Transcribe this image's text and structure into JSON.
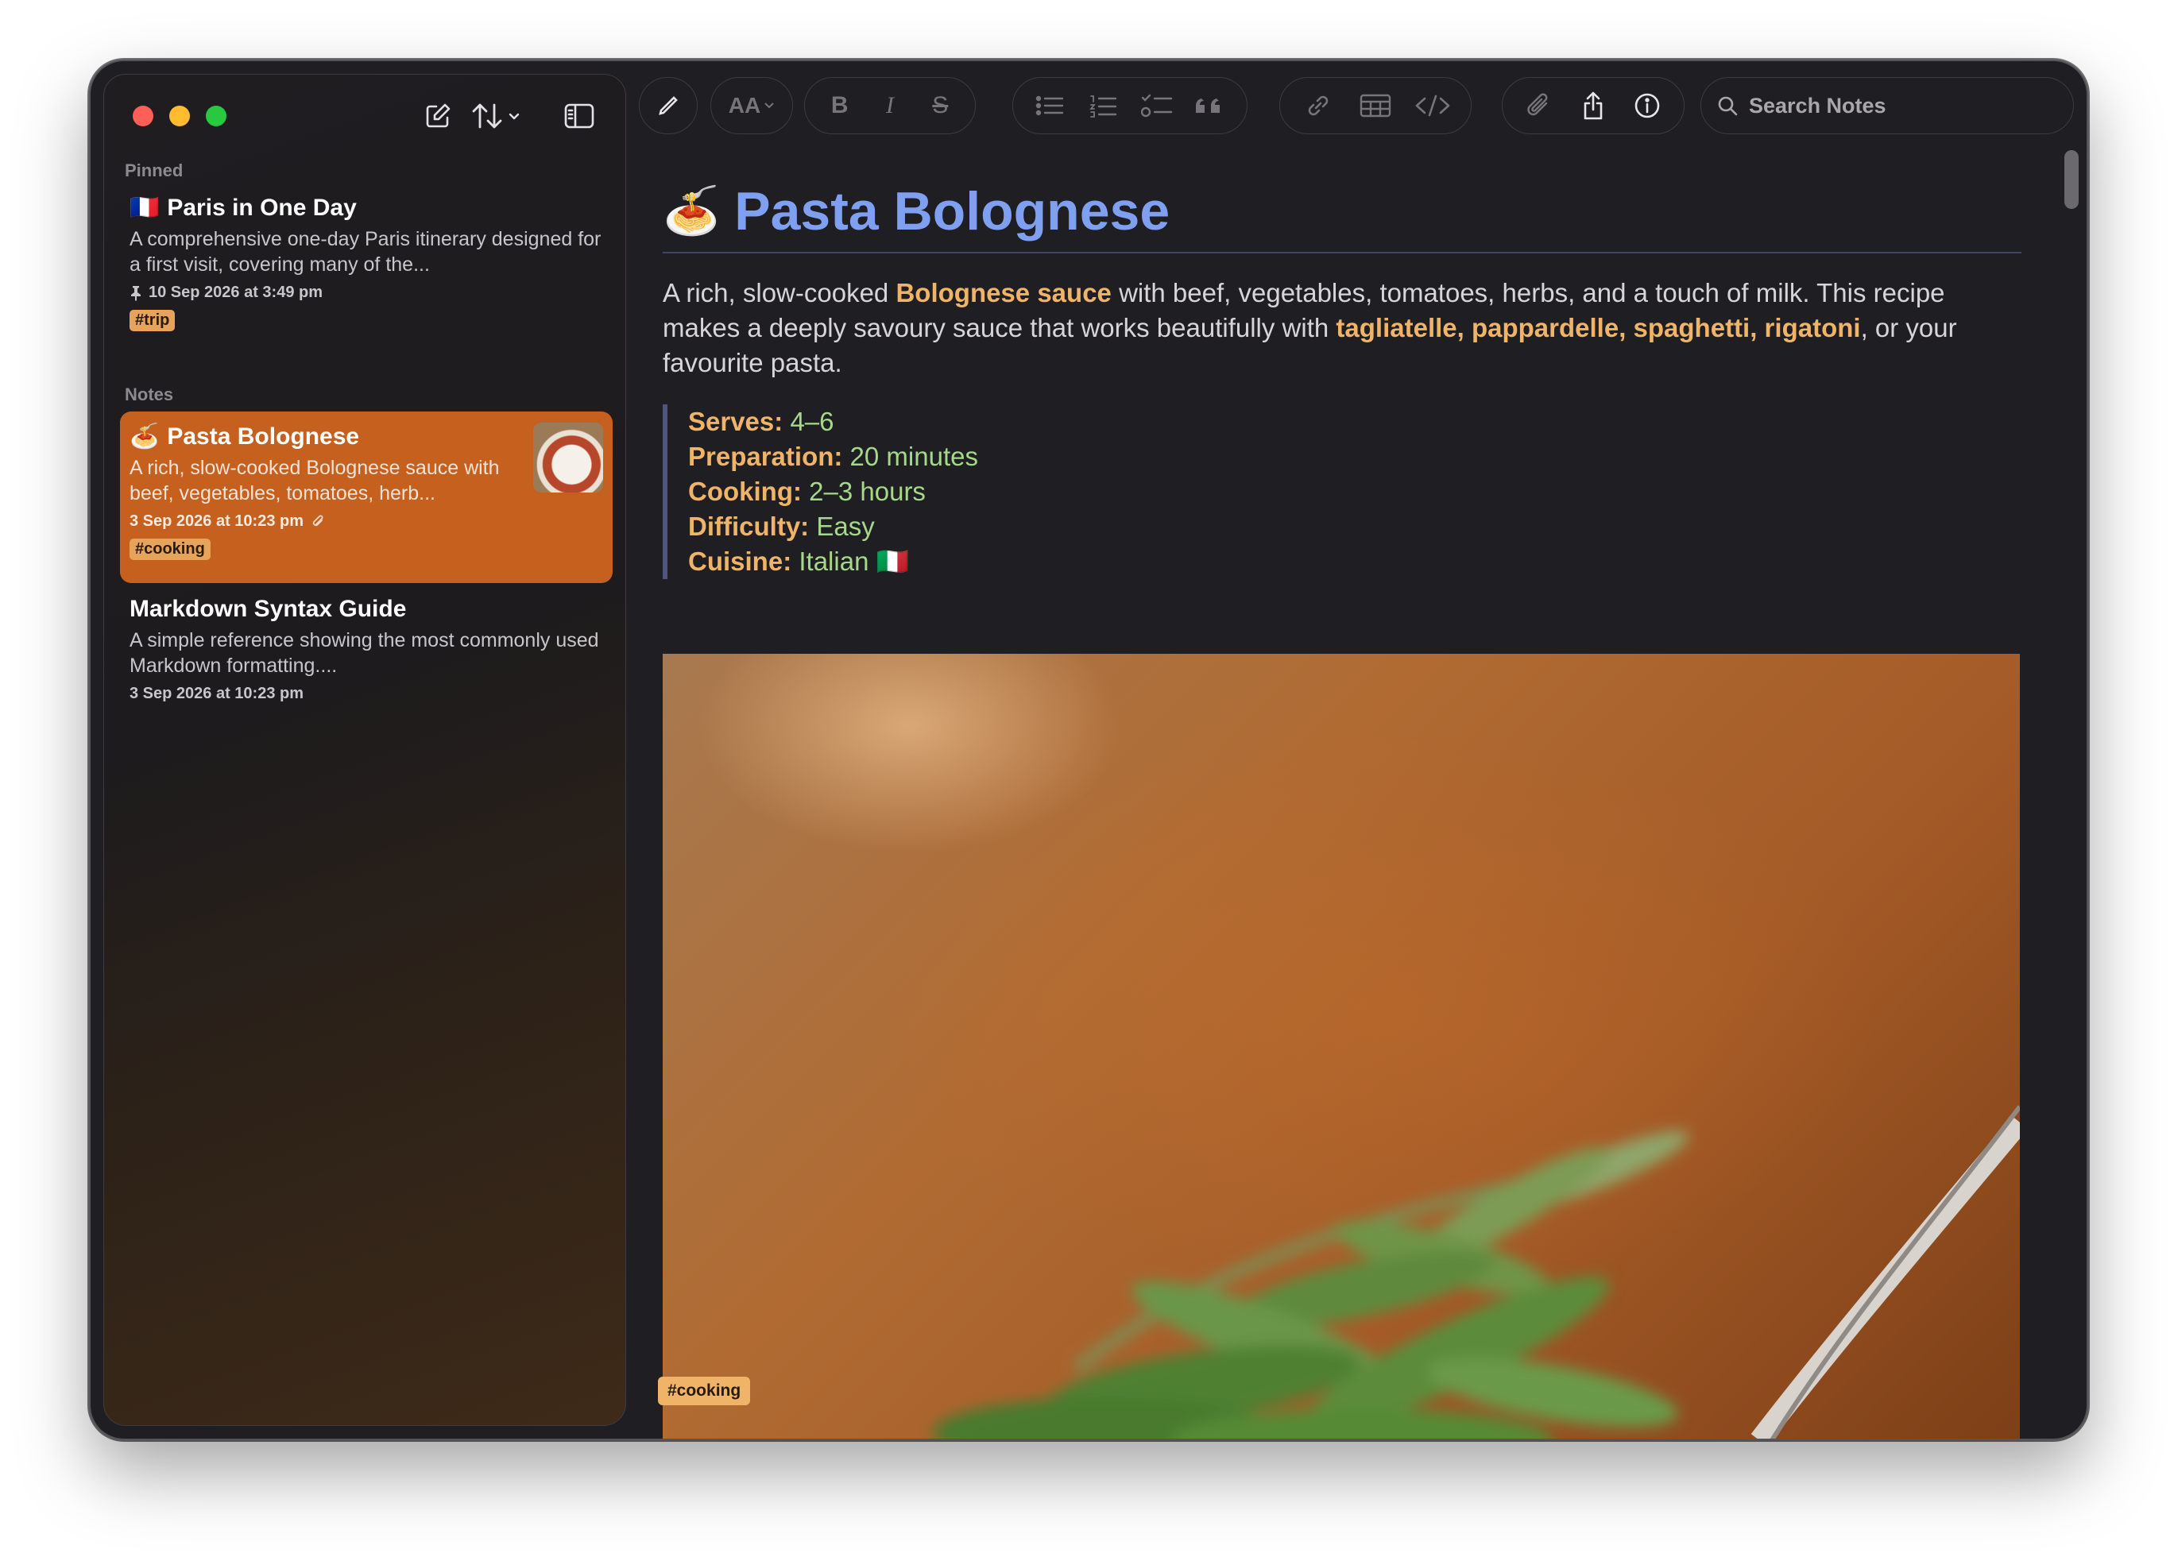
{
  "toolbar": {
    "search_placeholder": "Search Notes",
    "font_size_label": "AA",
    "bold_label": "B",
    "italic_label": "I",
    "strike_label": "S"
  },
  "sidebar": {
    "pinned_label": "Pinned",
    "notes_label": "Notes",
    "pinned_notes": [
      {
        "emoji": "🇫🇷",
        "title": "Paris in One Day",
        "excerpt": "A comprehensive one-day Paris itinerary designed for a first visit, covering many of the...",
        "date": "10 Sep 2026 at 3:49 pm",
        "tag": "#trip"
      }
    ],
    "notes": [
      {
        "emoji": "🍝",
        "title": "Pasta Bolognese",
        "excerpt": "A rich, slow-cooked Bolognese sauce with beef, vegetables, tomatoes, herb...",
        "date": "3 Sep 2026 at 10:23 pm",
        "tag": "#cooking",
        "active": true
      },
      {
        "title": "Markdown Syntax Guide",
        "excerpt": "A simple reference showing the most commonly used Markdown formatting....",
        "date": "3 Sep 2026 at 10:23 pm"
      }
    ]
  },
  "editor": {
    "title_emoji": "🍝",
    "title": "Pasta Bolognese",
    "intro": {
      "p1": "A rich, slow-cooked ",
      "b1": "Bolognese sauce",
      "p2": " with beef, vegetables, tomatoes, herbs, and a touch of milk. This recipe makes a deeply savoury sauce that works beautifully with ",
      "b2": "tagliatelle, pappardelle, spaghetti, rigatoni",
      "p3": ", or your favourite pasta."
    },
    "details": [
      {
        "label": "Serves:",
        "value": "4–6"
      },
      {
        "label": "Preparation:",
        "value": "20 minutes"
      },
      {
        "label": "Cooking:",
        "value": "2–3 hours"
      },
      {
        "label": "Difficulty:",
        "value": "Easy"
      },
      {
        "label": "Cuisine:",
        "value": "Italian 🇮🇹"
      }
    ],
    "image_tag": "#cooking"
  },
  "colors": {
    "accent_selected": "#c6601e",
    "heading": "#7f9ff0",
    "highlight": "#efb468",
    "value_green": "#a6d88a"
  },
  "icons": [
    "compose-icon",
    "sort-icon",
    "sidebar-toggle-icon",
    "pen-icon",
    "font-size-icon",
    "bold-icon",
    "italic-icon",
    "strikethrough-icon",
    "bullet-list-icon",
    "numbered-list-icon",
    "checklist-icon",
    "quote-icon",
    "link-icon",
    "table-icon",
    "code-icon",
    "attachment-icon",
    "share-icon",
    "info-icon",
    "search-icon",
    "pin-icon",
    "paperclip-icon"
  ]
}
